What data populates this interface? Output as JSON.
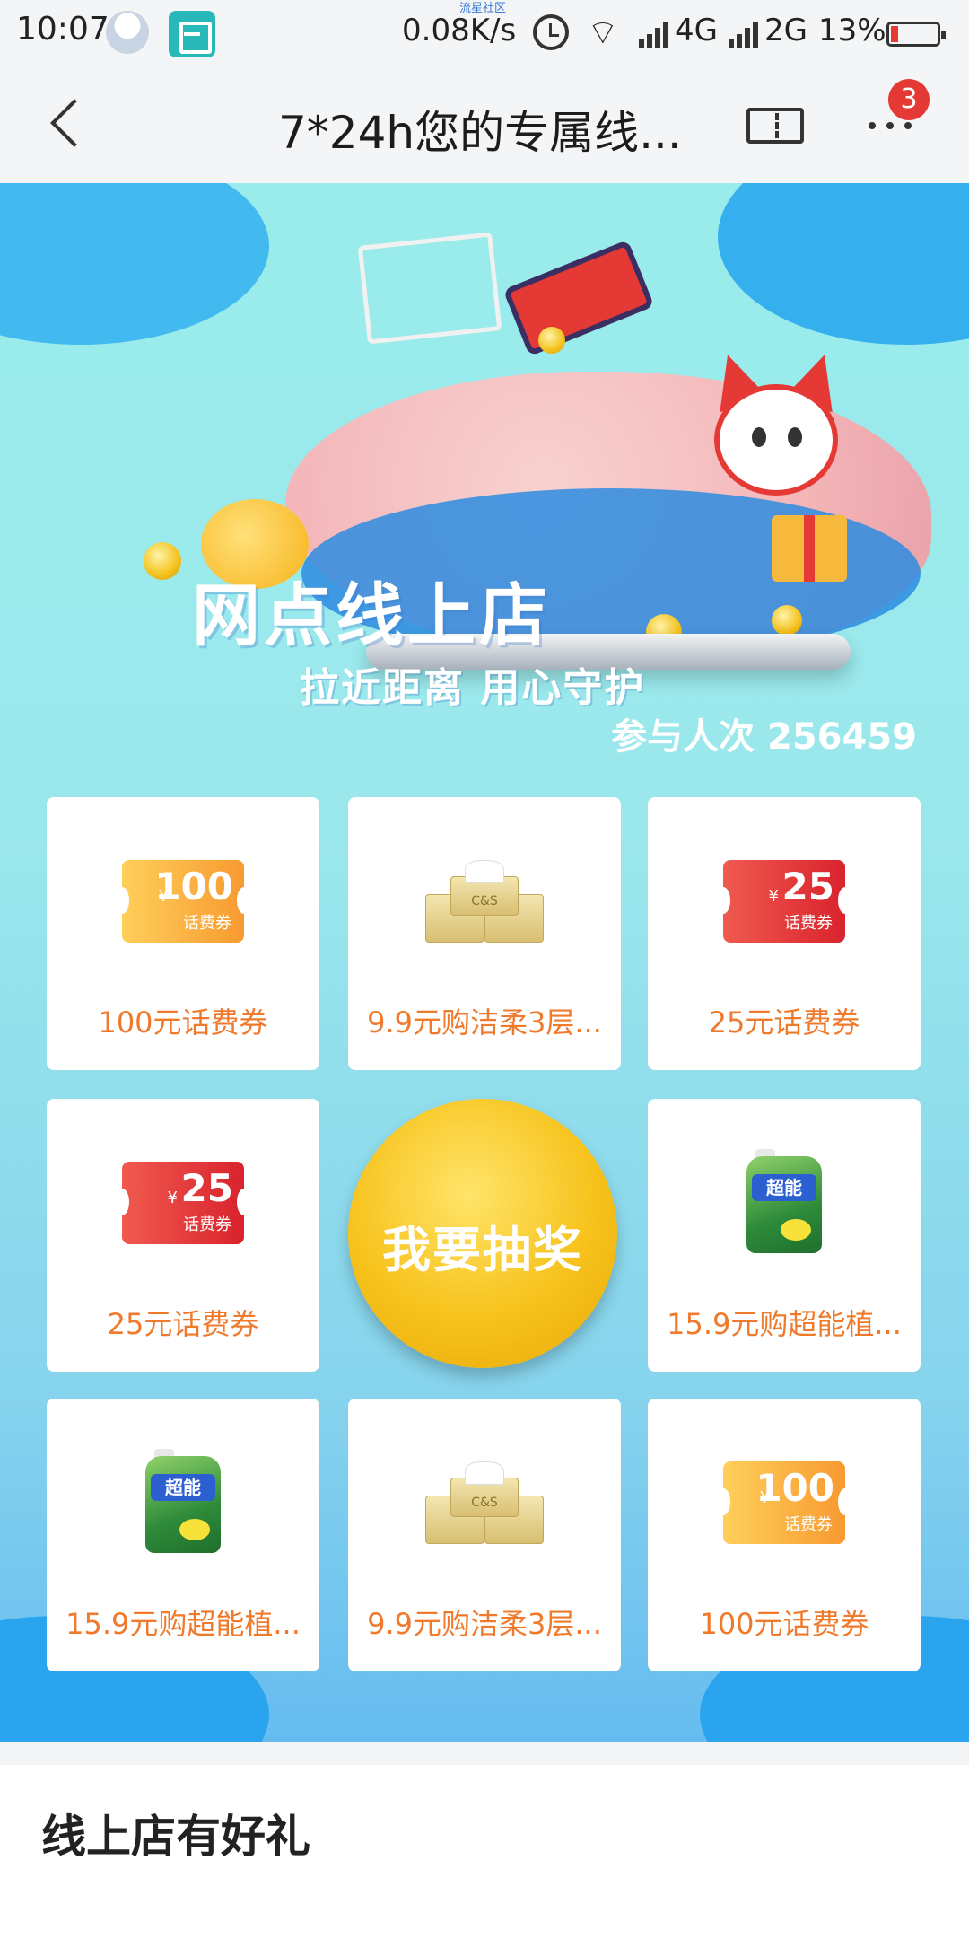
{
  "status_bar": {
    "time": "10:07",
    "top_tiny": "流星社区",
    "speed": "0.08K/s",
    "network1": "4G",
    "network2": "2G",
    "battery_pct": "13%",
    "icons": [
      "qq-avatar-icon",
      "scan-icon",
      "alarm-icon",
      "wifi-icon",
      "signal-icon",
      "battery-icon"
    ]
  },
  "nav": {
    "title": "7*24h您的专属线...",
    "badge_count": "3",
    "icons": [
      "back-icon",
      "ticket-icon",
      "more-icon"
    ]
  },
  "hero": {
    "title": "网点线上店",
    "subtitle": "拉近距离 用心守护",
    "participants": "参与人次 256459"
  },
  "prizes": [
    {
      "label": "100元话费券",
      "kind": "voucher",
      "amount": "100",
      "color": "#f79a31"
    },
    {
      "label": "9.9元购洁柔3层...",
      "kind": "tissue",
      "brand": "C&S"
    },
    {
      "label": "25元话费券",
      "kind": "voucher",
      "amount": "25",
      "color": "#d9232d"
    },
    {
      "label": "25元话费券",
      "kind": "voucher",
      "amount": "25",
      "color": "#d9232d"
    },
    {
      "label": "15.9元购超能植...",
      "kind": "detergent",
      "brand": "超能"
    },
    {
      "label": "15.9元购超能植...",
      "kind": "detergent",
      "brand": "超能"
    },
    {
      "label": "9.9元购洁柔3层...",
      "kind": "tissue",
      "brand": "C&S"
    },
    {
      "label": "100元话费券",
      "kind": "voucher",
      "amount": "100",
      "color": "#f79a31"
    }
  ],
  "voucher_sub": "话费券",
  "yen": "¥",
  "draw_button": "我要抽奖",
  "bottom": {
    "title": "线上店有好礼"
  },
  "colors": {
    "accent_orange": "#f07a2c",
    "hero_bg": "#9aeceb",
    "badge_red": "#e53935"
  }
}
